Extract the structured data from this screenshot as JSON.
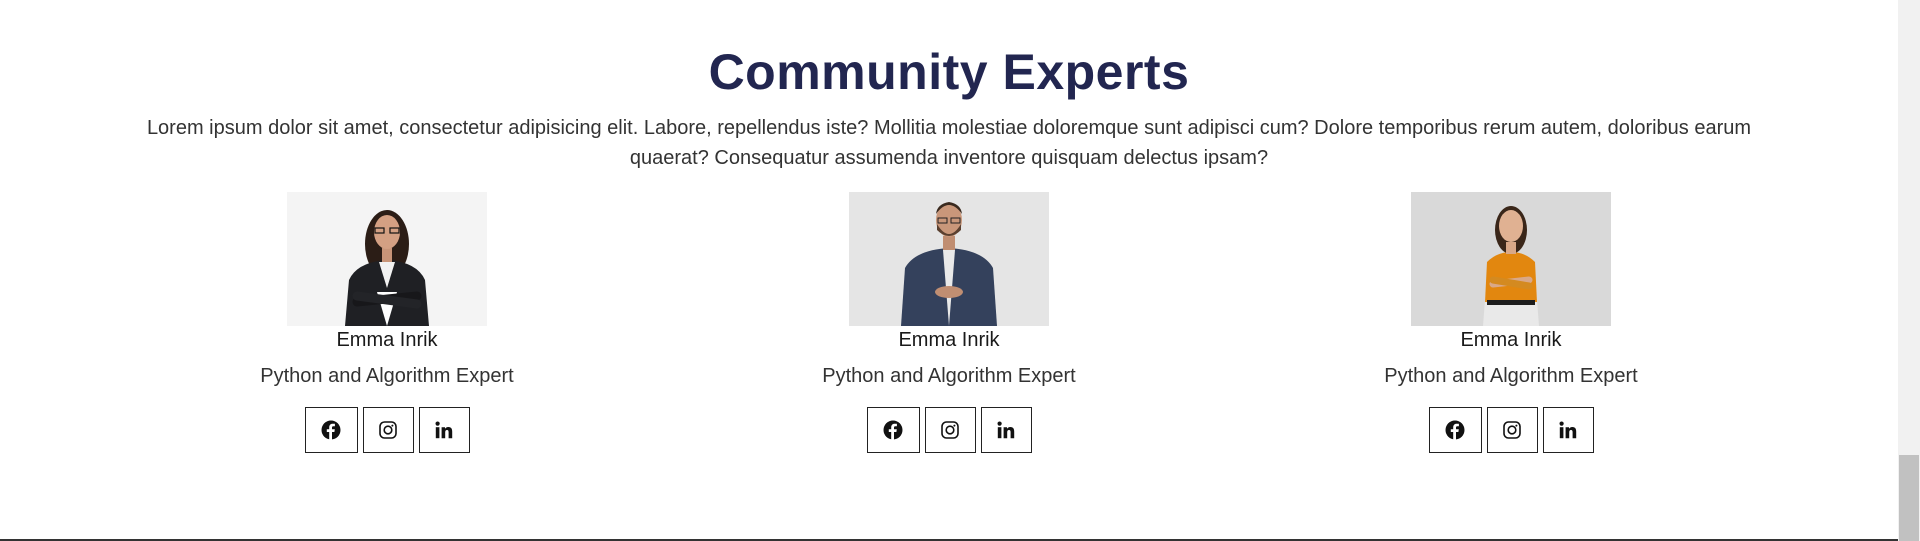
{
  "section": {
    "title": "Community Experts",
    "intro": "Lorem ipsum dolor sit amet, consectetur adipisicing elit. Labore, repellendus iste? Mollitia molestiae doloremque sunt adipisci cum? Dolore temporibus rerum autem, doloribus earum quaerat? Consequatur assumenda inventore quisquam delectus ipsam?"
  },
  "experts": [
    {
      "name": "Emma Inrik",
      "role": "Python and Algorithm Expert",
      "photo": "woman-black-blazer-portrait"
    },
    {
      "name": "Emma Inrik",
      "role": "Python and Algorithm Expert",
      "photo": "man-navy-shirt-portrait"
    },
    {
      "name": "Emma Inrik",
      "role": "Python and Algorithm Expert",
      "photo": "woman-orange-top-portrait"
    }
  ],
  "social_icons": [
    "facebook-icon",
    "instagram-icon",
    "linkedin-icon"
  ],
  "colors": {
    "title": "#222650",
    "text": "#333333",
    "border": "#222222"
  }
}
